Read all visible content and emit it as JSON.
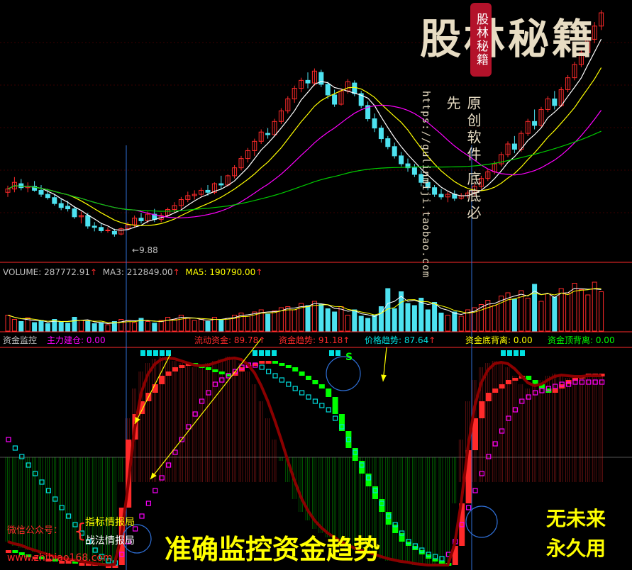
{
  "colors": {
    "up": "#ff2a2a",
    "down": "#4de2f0",
    "ma5": "#ffffff",
    "ma10": "#ffff00",
    "ma20": "#ff00ff",
    "ma60": "#00cc00",
    "grid": "#3a0000",
    "divider": "#ff2a2a",
    "vline": "#2f6fd6",
    "yellow": "#ffff00",
    "red": "#ff2a2a",
    "magenta": "#ff00ff",
    "cyan": "#00e0e0",
    "green": "#00ff00",
    "white": "#ffffff"
  },
  "price": {
    "low_marker": "9.88",
    "watermark_title": "股林秘籍",
    "watermark_seal": "股林秘籍",
    "watermark_sub": "原创软件 底底必先",
    "watermark_url": "https://gulinmiji.taobao.com"
  },
  "volume_header": {
    "volume": "VOLUME: 287772.91",
    "ma3": "MA3: 212849.00",
    "ma5": "MA5: 190790.00",
    "arrow": "↑"
  },
  "indicator_header": {
    "name": "资金监控",
    "main_buildup": "主力建仓: 0.00",
    "liquidity": "流动资金: 89.78",
    "fund_trend": "资金趋势: 91.18",
    "price_trend": "价格趋势: 87.64",
    "bottom_divergence": "资金底背离: 0.00",
    "top_divergence": "资金顶背离: 0.00",
    "arrow": "↑"
  },
  "overlay": {
    "wechat_label": "微信公众号：",
    "brace": "{",
    "bureau1": "指标情报局",
    "bureau2": "战法情报局",
    "website": "www.zhibiao168.com",
    "slogan": "准确监控资金趋势",
    "right1": "无未来",
    "right2": "永久用",
    "s_marker": "S"
  },
  "chart_data": {
    "type": "candlestick",
    "title": "",
    "candles": [
      [
        10.55,
        10.65,
        10.48,
        10.6
      ],
      [
        10.6,
        10.78,
        10.55,
        10.7
      ],
      [
        10.68,
        10.75,
        10.58,
        10.62
      ],
      [
        10.62,
        10.7,
        10.55,
        10.64
      ],
      [
        10.64,
        10.72,
        10.56,
        10.58
      ],
      [
        10.58,
        10.66,
        10.48,
        10.52
      ],
      [
        10.52,
        10.6,
        10.44,
        10.47
      ],
      [
        10.47,
        10.52,
        10.35,
        10.38
      ],
      [
        10.38,
        10.46,
        10.28,
        10.32
      ],
      [
        10.34,
        10.42,
        10.26,
        10.3
      ],
      [
        10.3,
        10.34,
        10.15,
        10.18
      ],
      [
        10.18,
        10.26,
        10.08,
        10.2
      ],
      [
        10.2,
        10.24,
        10.0,
        10.04
      ],
      [
        10.04,
        10.1,
        9.96,
        10.02
      ],
      [
        10.02,
        10.08,
        9.94,
        9.97
      ],
      [
        9.97,
        10.02,
        9.94,
        9.98
      ],
      [
        9.96,
        10.0,
        9.88,
        9.92
      ],
      [
        9.92,
        10.02,
        9.9,
        10.0
      ],
      [
        10.0,
        10.1,
        9.98,
        10.06
      ],
      [
        10.06,
        10.2,
        10.02,
        10.16
      ],
      [
        10.16,
        10.24,
        10.08,
        10.12
      ],
      [
        10.12,
        10.26,
        10.08,
        10.22
      ],
      [
        10.22,
        10.3,
        10.1,
        10.14
      ],
      [
        10.14,
        10.24,
        10.1,
        10.2
      ],
      [
        10.2,
        10.32,
        10.18,
        10.29
      ],
      [
        10.29,
        10.4,
        10.24,
        10.35
      ],
      [
        10.35,
        10.48,
        10.3,
        10.44
      ],
      [
        10.44,
        10.56,
        10.4,
        10.5
      ],
      [
        10.5,
        10.58,
        10.44,
        10.52
      ],
      [
        10.52,
        10.62,
        10.48,
        10.58
      ],
      [
        10.58,
        10.66,
        10.5,
        10.55
      ],
      [
        10.55,
        10.7,
        10.52,
        10.68
      ],
      [
        10.68,
        10.8,
        10.6,
        10.66
      ],
      [
        10.66,
        10.82,
        10.64,
        10.8
      ],
      [
        10.8,
        10.96,
        10.76,
        10.92
      ],
      [
        10.92,
        11.1,
        10.88,
        11.06
      ],
      [
        11.06,
        11.22,
        11.0,
        11.18
      ],
      [
        11.18,
        11.36,
        11.1,
        11.32
      ],
      [
        11.32,
        11.5,
        11.28,
        11.46
      ],
      [
        11.44,
        11.52,
        11.36,
        11.42
      ],
      [
        11.42,
        11.66,
        11.4,
        11.62
      ],
      [
        11.62,
        11.82,
        11.58,
        11.78
      ],
      [
        11.78,
        12.0,
        11.74,
        11.96
      ],
      [
        11.96,
        12.16,
        11.9,
        12.12
      ],
      [
        12.12,
        12.28,
        12.06,
        12.24
      ],
      [
        12.24,
        12.36,
        12.12,
        12.2
      ],
      [
        12.2,
        12.42,
        12.16,
        12.38
      ],
      [
        12.36,
        12.4,
        12.14,
        12.18
      ],
      [
        12.18,
        12.22,
        11.96,
        12.02
      ],
      [
        12.02,
        12.1,
        11.84,
        11.88
      ],
      [
        11.88,
        12.12,
        11.86,
        12.08
      ],
      [
        12.08,
        12.26,
        12.04,
        12.22
      ],
      [
        12.2,
        12.24,
        12.0,
        12.04
      ],
      [
        12.04,
        12.08,
        11.82,
        11.86
      ],
      [
        11.86,
        11.92,
        11.62,
        11.66
      ],
      [
        11.66,
        11.74,
        11.46,
        11.52
      ],
      [
        11.52,
        11.56,
        11.3,
        11.36
      ],
      [
        11.36,
        11.4,
        11.2,
        11.24
      ],
      [
        11.24,
        11.3,
        11.06,
        11.1
      ],
      [
        11.1,
        11.16,
        10.94,
        10.98
      ],
      [
        10.98,
        11.06,
        10.86,
        10.92
      ],
      [
        10.92,
        10.98,
        10.78,
        10.82
      ],
      [
        10.82,
        10.88,
        10.64,
        10.7
      ],
      [
        10.7,
        10.76,
        10.58,
        10.62
      ],
      [
        10.62,
        10.66,
        10.48,
        10.52
      ],
      [
        10.52,
        10.6,
        10.44,
        10.48
      ],
      [
        10.48,
        10.56,
        10.4,
        10.52
      ],
      [
        10.52,
        10.58,
        10.42,
        10.46
      ],
      [
        10.46,
        10.54,
        10.44,
        10.5
      ],
      [
        10.5,
        10.58,
        10.46,
        10.54
      ],
      [
        10.54,
        10.68,
        10.5,
        10.64
      ],
      [
        10.64,
        10.8,
        10.6,
        10.76
      ],
      [
        10.76,
        10.9,
        10.72,
        10.86
      ],
      [
        10.86,
        11.02,
        10.82,
        10.98
      ],
      [
        10.98,
        11.16,
        10.94,
        11.12
      ],
      [
        11.12,
        11.32,
        11.08,
        11.28
      ],
      [
        11.28,
        11.4,
        11.14,
        11.2
      ],
      [
        11.2,
        11.48,
        11.16,
        11.44
      ],
      [
        11.44,
        11.66,
        11.4,
        11.62
      ],
      [
        11.62,
        11.8,
        11.5,
        11.56
      ],
      [
        11.56,
        11.84,
        11.54,
        11.8
      ],
      [
        11.8,
        12.0,
        11.76,
        11.96
      ],
      [
        11.96,
        12.08,
        11.8,
        11.86
      ],
      [
        11.86,
        12.14,
        11.84,
        12.1
      ],
      [
        12.1,
        12.32,
        12.06,
        12.28
      ],
      [
        12.28,
        12.52,
        12.24,
        12.48
      ],
      [
        12.48,
        12.7,
        12.44,
        12.66
      ],
      [
        12.66,
        12.9,
        12.62,
        12.86
      ],
      [
        12.86,
        13.12,
        12.8,
        13.06
      ],
      [
        13.06,
        13.3,
        13.0,
        13.26
      ]
    ],
    "volume": [
      0.3,
      0.22,
      0.18,
      0.25,
      0.16,
      0.2,
      0.14,
      0.22,
      0.18,
      0.15,
      0.26,
      0.2,
      0.18,
      0.14,
      0.16,
      0.12,
      0.18,
      0.22,
      0.2,
      0.16,
      0.24,
      0.18,
      0.15,
      0.2,
      0.26,
      0.22,
      0.3,
      0.24,
      0.2,
      0.22,
      0.18,
      0.26,
      0.22,
      0.24,
      0.3,
      0.34,
      0.28,
      0.36,
      0.4,
      0.32,
      0.38,
      0.44,
      0.46,
      0.4,
      0.52,
      0.48,
      0.56,
      0.5,
      0.42,
      0.36,
      0.46,
      0.3,
      0.4,
      0.28,
      0.24,
      0.3,
      0.46,
      0.8,
      0.42,
      0.74,
      0.52,
      0.48,
      0.62,
      0.4,
      0.54,
      0.34,
      0.3,
      0.36,
      0.28,
      0.4,
      0.44,
      0.5,
      0.58,
      0.48,
      0.66,
      0.72,
      0.6,
      0.76,
      0.62,
      0.88,
      0.56,
      0.7,
      0.64,
      0.8,
      0.72,
      0.9,
      0.78,
      0.68,
      0.92,
      0.74
    ],
    "fund_trend": [
      8,
      7,
      6,
      5,
      5,
      4,
      4,
      3,
      3,
      3,
      2,
      2,
      2,
      2,
      1,
      1,
      1,
      28,
      60,
      72,
      78,
      82,
      86,
      90,
      92,
      94,
      95,
      96,
      95,
      94,
      93,
      92,
      91,
      90,
      92,
      94,
      95,
      96,
      97,
      97,
      96,
      95,
      94,
      92,
      90,
      88,
      86,
      84,
      80,
      72,
      64,
      56,
      50,
      44,
      38,
      32,
      26,
      20,
      16,
      12,
      10,
      8,
      6,
      4,
      3,
      2,
      1,
      10,
      30,
      55,
      70,
      78,
      82,
      84,
      86,
      88,
      89,
      90,
      88,
      86,
      84,
      82,
      84,
      86,
      88,
      89,
      90,
      91,
      91,
      91
    ],
    "price_trend": [
      60,
      56,
      52,
      48,
      44,
      40,
      36,
      32,
      28,
      24,
      20,
      16,
      12,
      8,
      5,
      3,
      2,
      6,
      12,
      18,
      24,
      30,
      36,
      42,
      48,
      54,
      60,
      66,
      72,
      78,
      82,
      86,
      88,
      90,
      92,
      94,
      95,
      95,
      94,
      92,
      90,
      88,
      86,
      84,
      82,
      80,
      78,
      76,
      74,
      70,
      66,
      60,
      54,
      48,
      42,
      36,
      30,
      24,
      20,
      16,
      12,
      10,
      8,
      6,
      5,
      4,
      6,
      12,
      20,
      28,
      36,
      44,
      52,
      58,
      64,
      70,
      74,
      78,
      80,
      82,
      83,
      84,
      85,
      86,
      86,
      87,
      87,
      87,
      87,
      87
    ],
    "liquidity": [
      12,
      10,
      9,
      8,
      7,
      6,
      5,
      4,
      4,
      3,
      3,
      2,
      2,
      1,
      1,
      1,
      2,
      40,
      70,
      84,
      92,
      96,
      98,
      99,
      98,
      97,
      96,
      95,
      94,
      95,
      96,
      97,
      98,
      99,
      98,
      96,
      92,
      86,
      78,
      70,
      60,
      50,
      40,
      32,
      26,
      22,
      18,
      16,
      14,
      12,
      10,
      9,
      8,
      7,
      6,
      5,
      4,
      3,
      3,
      2,
      2,
      1,
      1,
      1,
      1,
      1,
      1,
      30,
      60,
      78,
      88,
      94,
      96,
      97,
      96,
      94,
      90,
      86,
      84,
      86,
      88,
      90,
      91,
      90,
      89,
      90,
      90,
      90,
      90,
      90
    ]
  }
}
